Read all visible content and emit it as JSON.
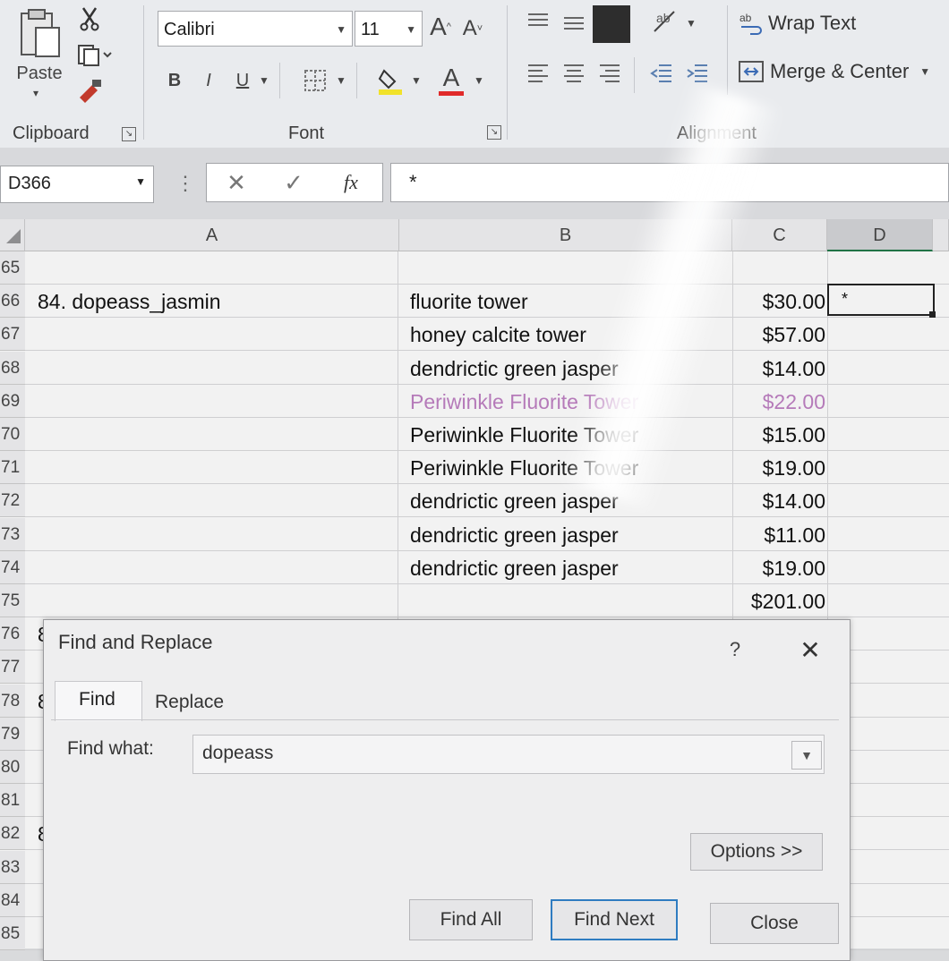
{
  "ribbon": {
    "clipboard": {
      "paste_label": "Paste",
      "group_label": "Clipboard"
    },
    "font": {
      "font_name": "Calibri",
      "font_size": "11",
      "bold": "B",
      "italic": "I",
      "underline": "U",
      "group_label": "Font",
      "grow": "A",
      "shrink": "A",
      "font_color": "A"
    },
    "alignment": {
      "wrap_text": "Wrap Text",
      "merge_center": "Merge & Center",
      "group_label": "Alignment"
    }
  },
  "formula_bar": {
    "name_box": "D366",
    "fx": "fx",
    "content": "*"
  },
  "columns": [
    "A",
    "B",
    "C",
    "D"
  ],
  "rows": [
    {
      "num": "65",
      "a": "",
      "b": "",
      "c": "",
      "d": ""
    },
    {
      "num": "66",
      "a": "84. dopeass_jasmin",
      "b": "fluorite tower",
      "c": "$30.00",
      "d": "*"
    },
    {
      "num": "67",
      "a": "",
      "b": "honey calcite tower",
      "c": "$57.00",
      "d": ""
    },
    {
      "num": "68",
      "a": "",
      "b": "dendrictic green jasper",
      "c": "$14.00",
      "d": ""
    },
    {
      "num": "69",
      "a": "",
      "b": "Periwinkle Fluorite Tower",
      "c": "$22.00",
      "d": ""
    },
    {
      "num": "70",
      "a": "",
      "b": "Periwinkle Fluorite Tower",
      "c": "$15.00",
      "d": ""
    },
    {
      "num": "71",
      "a": "",
      "b": "Periwinkle Fluorite Tower",
      "c": "$19.00",
      "d": ""
    },
    {
      "num": "72",
      "a": "",
      "b": "dendrictic green jasper",
      "c": "$14.00",
      "d": ""
    },
    {
      "num": "73",
      "a": "",
      "b": "dendrictic green jasper",
      "c": "$11.00",
      "d": ""
    },
    {
      "num": "74",
      "a": "",
      "b": "dendrictic green jasper",
      "c": "$19.00",
      "d": ""
    },
    {
      "num": "75",
      "a": "",
      "b": "",
      "c": "$201.00",
      "d": ""
    },
    {
      "num": "76",
      "a": "8",
      "b": "",
      "c": "",
      "d": ""
    },
    {
      "num": "77",
      "a": "",
      "b": "",
      "c": "",
      "d": ""
    },
    {
      "num": "78",
      "a": "8",
      "b": "",
      "c": "",
      "d": ""
    },
    {
      "num": "79",
      "a": "",
      "b": "",
      "c": "",
      "d": ""
    },
    {
      "num": "80",
      "a": "",
      "b": "",
      "c": "",
      "d": ""
    },
    {
      "num": "81",
      "a": "",
      "b": "",
      "c": "",
      "d": ""
    },
    {
      "num": "82",
      "a": "8",
      "b": "",
      "c": "",
      "d": ""
    },
    {
      "num": "83",
      "a": "",
      "b": "",
      "c": "",
      "d": ""
    },
    {
      "num": "84",
      "a": "",
      "b": "",
      "c": "",
      "d": ""
    },
    {
      "num": "85",
      "a": "",
      "b": "",
      "c": "",
      "d": ""
    }
  ],
  "colors": {
    "highlight_text": "#b57ab9"
  },
  "dialog": {
    "title": "Find and Replace",
    "help": "?",
    "close_x": "✕",
    "tab_find": "Find",
    "tab_replace": "Replace",
    "find_what_label": "Find what:",
    "find_what_value": "dopeass",
    "options_button": "Options >>",
    "find_all_button": "Find All",
    "find_next_button": "Find Next",
    "close_button": "Close"
  }
}
